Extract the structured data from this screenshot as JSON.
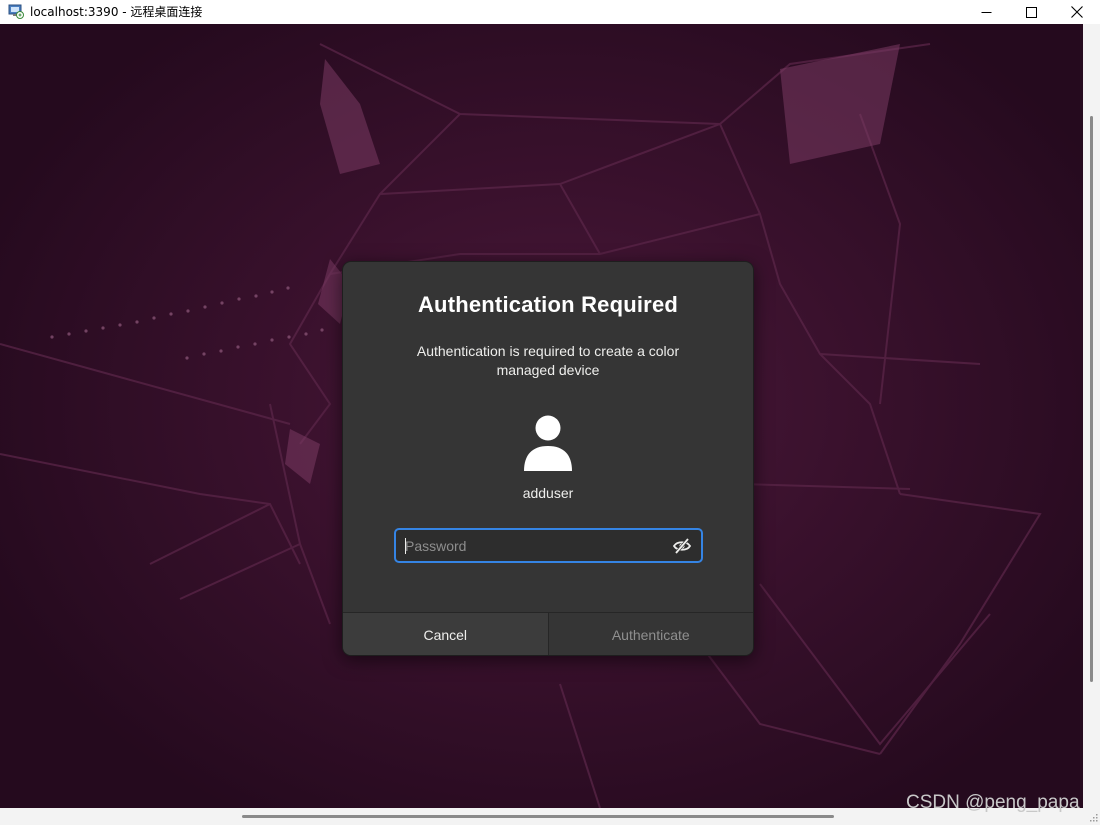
{
  "window": {
    "title": "localhost:3390 - 远程桌面连接",
    "icon": "remote-desktop-icon",
    "controls": [
      "minimize-icon",
      "maximize-icon",
      "close-icon"
    ]
  },
  "dialog": {
    "title": "Authentication Required",
    "message": "Authentication is required to create a color managed device",
    "avatar_icon": "user-avatar-icon",
    "username": "adduser",
    "password": {
      "value": "",
      "placeholder": "Password",
      "reveal_icon": "eye-hidden-icon"
    },
    "buttons": {
      "cancel": "Cancel",
      "authenticate": "Authenticate"
    }
  },
  "watermark": "CSDN @peng_papa",
  "colors": {
    "accent": "#3584e4",
    "dialog_bg": "#353535",
    "desktop_bg": "#3a112d"
  }
}
